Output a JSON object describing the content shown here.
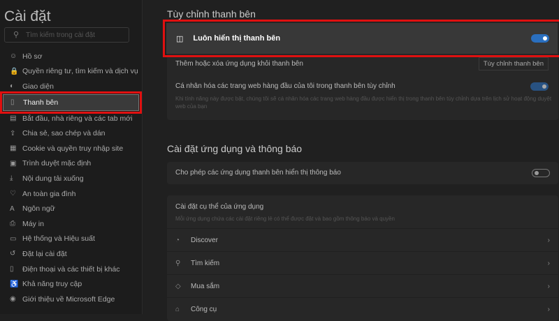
{
  "sidebar": {
    "title": "Cài đặt",
    "search_placeholder": "Tìm kiếm trong cài đặt",
    "items": [
      {
        "label": "Hồ sơ",
        "icon": "☺"
      },
      {
        "label": "Quyền riêng tư, tìm kiếm và dịch vụ",
        "icon": "🔒"
      },
      {
        "label": "Giao diện",
        "icon": "◐"
      },
      {
        "label": "Thanh bên",
        "icon": "▯"
      },
      {
        "label": "Bắt đầu, nhà riêng và các tab mới",
        "icon": "▤"
      },
      {
        "label": "Chia sẻ, sao chép và dán",
        "icon": "⇪"
      },
      {
        "label": "Cookie và quyền truy nhập site",
        "icon": "▦"
      },
      {
        "label": "Trình duyệt mặc định",
        "icon": "▣"
      },
      {
        "label": "Nội dung tải xuống",
        "icon": "⤓"
      },
      {
        "label": "An toàn gia đình",
        "icon": "♡"
      },
      {
        "label": "Ngôn ngữ",
        "icon": "A"
      },
      {
        "label": "Máy in",
        "icon": "⎙"
      },
      {
        "label": "Hệ thống và Hiệu suất",
        "icon": "▭"
      },
      {
        "label": "Đặt lại cài đặt",
        "icon": "↺"
      },
      {
        "label": "Điện thoại và các thiết bị khác",
        "icon": "▯"
      },
      {
        "label": "Khả năng truy cập",
        "icon": "♿"
      },
      {
        "label": "Giới thiệu về Microsoft Edge",
        "icon": "◉"
      }
    ]
  },
  "main": {
    "section1": {
      "title": "Tùy chỉnh thanh bên",
      "always_show": "Luôn hiển thị thanh bên",
      "add_remove": "Thêm hoặc xóa ứng dụng khỏi thanh bên",
      "customize_button": "Tùy chỉnh thanh bên",
      "personalize": "Cá nhân hóa các trang web hàng đầu của tôi trong thanh bên tùy chỉnh",
      "personalize_desc": "Khi tính năng này được bật, chúng tôi sẽ cá nhân hóa các trang web hàng đầu được hiển thị trong thanh bên tùy chỉnh dựa trên lịch sử hoạt động duyệt web của bạn"
    },
    "section2": {
      "title": "Cài đặt ứng dụng và thông báo",
      "allow_notif": "Cho phép các ứng dụng thanh bên hiển thị thông báo",
      "app_specific": "Cài đặt cụ thể của ứng dụng",
      "app_specific_desc": "Mỗi ứng dụng chứa các cài đặt riêng lẻ có thể được đặt và bao gồm thông báo và quyền",
      "apps": [
        {
          "label": "Discover",
          "icon": "◔"
        },
        {
          "label": "Tìm kiếm",
          "icon": "⚲"
        },
        {
          "label": "Mua sắm",
          "icon": "◇"
        },
        {
          "label": "Công cụ",
          "icon": "⌂"
        }
      ]
    }
  },
  "colors": {
    "accent": "#2a6fbf",
    "highlight": "#e01010"
  }
}
